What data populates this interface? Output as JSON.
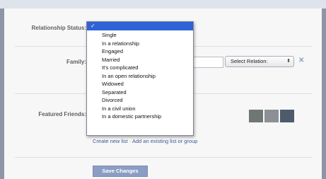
{
  "form": {
    "relationship_label": "Relationship Status:",
    "family_label": "Family:",
    "featured_label": "Featured Friends:",
    "relation_select": "Select Relation:",
    "remove_symbol": "✕",
    "links": {
      "create": "Create new list",
      "separator": "·",
      "add_existing": "Add an existing list or group"
    },
    "save_button": "Save Changes"
  },
  "dropdown": {
    "selected_check": "✓",
    "options": [
      "Single",
      "In a relationship",
      "Engaged",
      "Married",
      "It's complicated",
      "In an open relationship",
      "Widowed",
      "Separated",
      "Divorced",
      "In a civil union",
      "In a domestic partnership"
    ]
  },
  "colors": {
    "selection": "#2f62d6",
    "link": "#3b5998",
    "button": "#8b9dc3"
  }
}
